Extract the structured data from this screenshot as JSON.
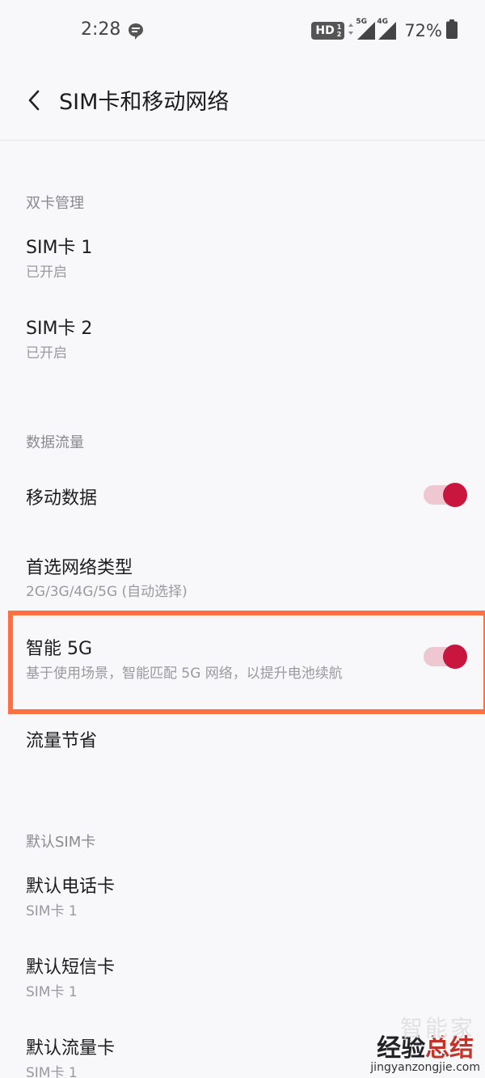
{
  "status_bar": {
    "time": "2:28",
    "hd_label": "HD",
    "hd_top": "1",
    "hd_bottom": "2",
    "sim1_network": "5G",
    "sim2_network": "4G",
    "battery_percent": "72%"
  },
  "header": {
    "title": "SIM卡和移动网络"
  },
  "sections": {
    "dual_sim": {
      "label": "双卡管理",
      "sim1": {
        "title": "SIM卡 1",
        "subtitle": "已开启"
      },
      "sim2": {
        "title": "SIM卡 2",
        "subtitle": "已开启"
      }
    },
    "data": {
      "label": "数据流量",
      "mobile_data": {
        "title": "移动数据",
        "enabled": true
      },
      "preferred_network": {
        "title": "首选网络类型",
        "subtitle": "2G/3G/4G/5G (自动选择)"
      },
      "smart_5g": {
        "title": "智能 5G",
        "subtitle": "基于使用场景，智能匹配 5G 网络，以提升电池续航",
        "enabled": true
      },
      "data_saver": {
        "title": "流量节省"
      }
    },
    "default_sim": {
      "label": "默认SIM卡",
      "calls": {
        "title": "默认电话卡",
        "subtitle": "SIM卡 1"
      },
      "sms": {
        "title": "默认短信卡",
        "subtitle": "SIM卡 1"
      },
      "data": {
        "title": "默认流量卡",
        "subtitle": "SIM卡 1"
      }
    }
  },
  "watermark": {
    "top": "智能家",
    "brand_a": "经验",
    "brand_b": "总结",
    "url": "jingyanzongjie.com"
  },
  "colors": {
    "accent": "#c8163e",
    "toggle_track": "#efc7d1",
    "highlight": "#ff7040",
    "background": "#f8f7f9"
  }
}
